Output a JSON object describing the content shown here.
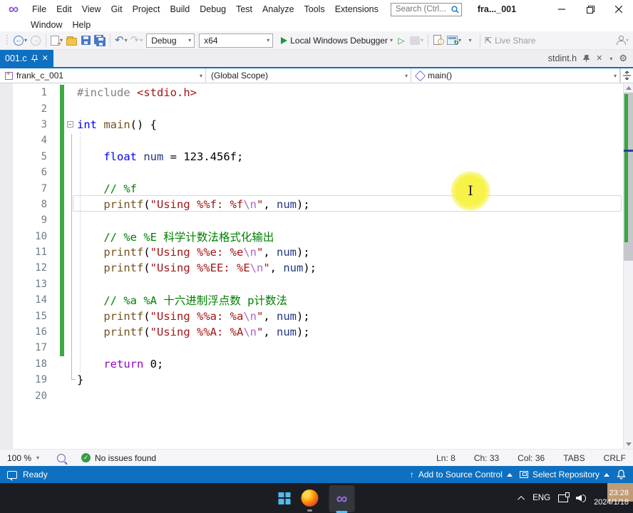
{
  "window": {
    "title": "fra..._001"
  },
  "menubar": {
    "row1": [
      "File",
      "Edit",
      "View",
      "Git",
      "Project",
      "Build",
      "Debug",
      "Test",
      "Analyze",
      "Tools",
      "Extensions"
    ],
    "row2": [
      "Window",
      "Help"
    ]
  },
  "search": {
    "placeholder": "Search (Ctrl..."
  },
  "toolbar": {
    "configuration": "Debug",
    "platform": "x64",
    "run_label": "Local Windows Debugger",
    "live_share_label": "Live Share"
  },
  "tabs": {
    "active": {
      "label": "001.c"
    },
    "preview": {
      "label": "stdint.h"
    }
  },
  "navbar": {
    "project": "frank_c_001",
    "scope": "(Global Scope)",
    "function": "main()"
  },
  "editor": {
    "cursor_line": 8,
    "lines": [
      {
        "n": 1,
        "chg": true,
        "segs": [
          {
            "c": "pre",
            "t": "#include "
          },
          {
            "c": "inc",
            "t": "<stdio.h>"
          }
        ]
      },
      {
        "n": 2,
        "chg": true,
        "segs": []
      },
      {
        "n": 3,
        "chg": true,
        "fold": "minus",
        "segs": [
          {
            "c": "kw",
            "t": "int"
          },
          {
            "c": "pl",
            "t": " "
          },
          {
            "c": "fn",
            "t": "main"
          },
          {
            "c": "pl",
            "t": "() {"
          }
        ]
      },
      {
        "n": 4,
        "chg": true,
        "segs": []
      },
      {
        "n": 5,
        "chg": true,
        "segs": [
          {
            "c": "pl",
            "t": "    "
          },
          {
            "c": "kw",
            "t": "float"
          },
          {
            "c": "pl",
            "t": " "
          },
          {
            "c": "id",
            "t": "num"
          },
          {
            "c": "pl",
            "t": " = "
          },
          {
            "c": "lit",
            "t": "123.456f"
          },
          {
            "c": "pl",
            "t": ";"
          }
        ]
      },
      {
        "n": 6,
        "chg": true,
        "segs": []
      },
      {
        "n": 7,
        "chg": true,
        "segs": [
          {
            "c": "pl",
            "t": "    "
          },
          {
            "c": "com",
            "t": "// %f"
          }
        ]
      },
      {
        "n": 8,
        "chg": true,
        "segs": [
          {
            "c": "pl",
            "t": "    "
          },
          {
            "c": "fn",
            "t": "printf"
          },
          {
            "c": "pl",
            "t": "("
          },
          {
            "c": "str",
            "t": "\"Using %%f: %f"
          },
          {
            "c": "esc",
            "t": "\\n"
          },
          {
            "c": "str",
            "t": "\""
          },
          {
            "c": "pl",
            "t": ", "
          },
          {
            "c": "id",
            "t": "num"
          },
          {
            "c": "pl",
            "t": ");"
          }
        ]
      },
      {
        "n": 9,
        "chg": true,
        "segs": []
      },
      {
        "n": 10,
        "chg": true,
        "segs": [
          {
            "c": "pl",
            "t": "    "
          },
          {
            "c": "com",
            "t": "// %e %E 科学计数法格式化输出"
          }
        ]
      },
      {
        "n": 11,
        "chg": true,
        "segs": [
          {
            "c": "pl",
            "t": "    "
          },
          {
            "c": "fn",
            "t": "printf"
          },
          {
            "c": "pl",
            "t": "("
          },
          {
            "c": "str",
            "t": "\"Using %%e: %e"
          },
          {
            "c": "esc",
            "t": "\\n"
          },
          {
            "c": "str",
            "t": "\""
          },
          {
            "c": "pl",
            "t": ", "
          },
          {
            "c": "id",
            "t": "num"
          },
          {
            "c": "pl",
            "t": ");"
          }
        ]
      },
      {
        "n": 12,
        "chg": true,
        "segs": [
          {
            "c": "pl",
            "t": "    "
          },
          {
            "c": "fn",
            "t": "printf"
          },
          {
            "c": "pl",
            "t": "("
          },
          {
            "c": "str",
            "t": "\"Using %%EE: %E"
          },
          {
            "c": "esc",
            "t": "\\n"
          },
          {
            "c": "str",
            "t": "\""
          },
          {
            "c": "pl",
            "t": ", "
          },
          {
            "c": "id",
            "t": "num"
          },
          {
            "c": "pl",
            "t": ");"
          }
        ]
      },
      {
        "n": 13,
        "chg": true,
        "segs": []
      },
      {
        "n": 14,
        "chg": true,
        "segs": [
          {
            "c": "pl",
            "t": "    "
          },
          {
            "c": "com",
            "t": "// %a %A 十六进制浮点数 p计数法"
          }
        ]
      },
      {
        "n": 15,
        "chg": true,
        "segs": [
          {
            "c": "pl",
            "t": "    "
          },
          {
            "c": "fn",
            "t": "printf"
          },
          {
            "c": "pl",
            "t": "("
          },
          {
            "c": "str",
            "t": "\"Using %%a: %a"
          },
          {
            "c": "esc",
            "t": "\\n"
          },
          {
            "c": "str",
            "t": "\""
          },
          {
            "c": "pl",
            "t": ", "
          },
          {
            "c": "id",
            "t": "num"
          },
          {
            "c": "pl",
            "t": ");"
          }
        ]
      },
      {
        "n": 16,
        "chg": true,
        "segs": [
          {
            "c": "pl",
            "t": "    "
          },
          {
            "c": "fn",
            "t": "printf"
          },
          {
            "c": "pl",
            "t": "("
          },
          {
            "c": "str",
            "t": "\"Using %%A: %A"
          },
          {
            "c": "esc",
            "t": "\\n"
          },
          {
            "c": "str",
            "t": "\""
          },
          {
            "c": "pl",
            "t": ", "
          },
          {
            "c": "id",
            "t": "num"
          },
          {
            "c": "pl",
            "t": ");"
          }
        ]
      },
      {
        "n": 17,
        "chg": true,
        "segs": []
      },
      {
        "n": 18,
        "chg": false,
        "segs": [
          {
            "c": "pl",
            "t": "    "
          },
          {
            "c": "ctrl",
            "t": "return"
          },
          {
            "c": "pl",
            "t": " "
          },
          {
            "c": "lit",
            "t": "0"
          },
          {
            "c": "pl",
            "t": ";"
          }
        ]
      },
      {
        "n": 19,
        "chg": false,
        "segs": [
          {
            "c": "pl",
            "t": "}"
          }
        ]
      },
      {
        "n": 20,
        "chg": false,
        "segs": []
      }
    ]
  },
  "editor_status": {
    "zoom": "100 %",
    "issues": "No issues found",
    "ln": "Ln: 8",
    "ch": "Ch: 33",
    "col": "Col: 36",
    "tabs": "TABS",
    "eol": "CRLF"
  },
  "status_bar": {
    "ready": "Ready",
    "source_control": "Add to Source Control",
    "repository": "Select Repository"
  },
  "taskbar": {
    "language": "ENG",
    "time": "23:28",
    "date": "2024/1/18"
  },
  "colors": {
    "accent_blue": "#0e70c0",
    "change_bar_green": "#3dab41",
    "comment_green": "#008000",
    "keyword_blue": "#0000ff",
    "string_red": "#a31515",
    "function_brown": "#74531f",
    "cursor_highlight_yellow": "#f7f23f",
    "taskbar_dark": "#1c1d22"
  }
}
